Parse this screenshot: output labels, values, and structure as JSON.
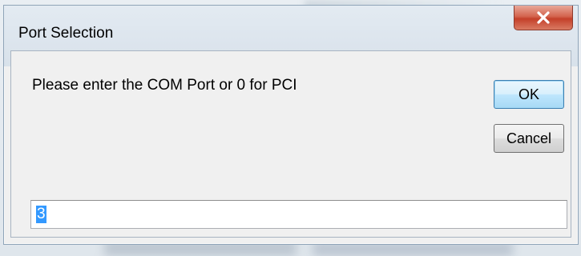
{
  "window": {
    "title": "Port Selection",
    "close_icon": "close-icon"
  },
  "dialog": {
    "prompt": "Please enter the COM Port or 0 for PCI",
    "ok_label": "OK",
    "cancel_label": "Cancel",
    "input_value": "3"
  },
  "colors": {
    "close_button": "#c4402a",
    "selection_highlight": "#3399ff"
  }
}
